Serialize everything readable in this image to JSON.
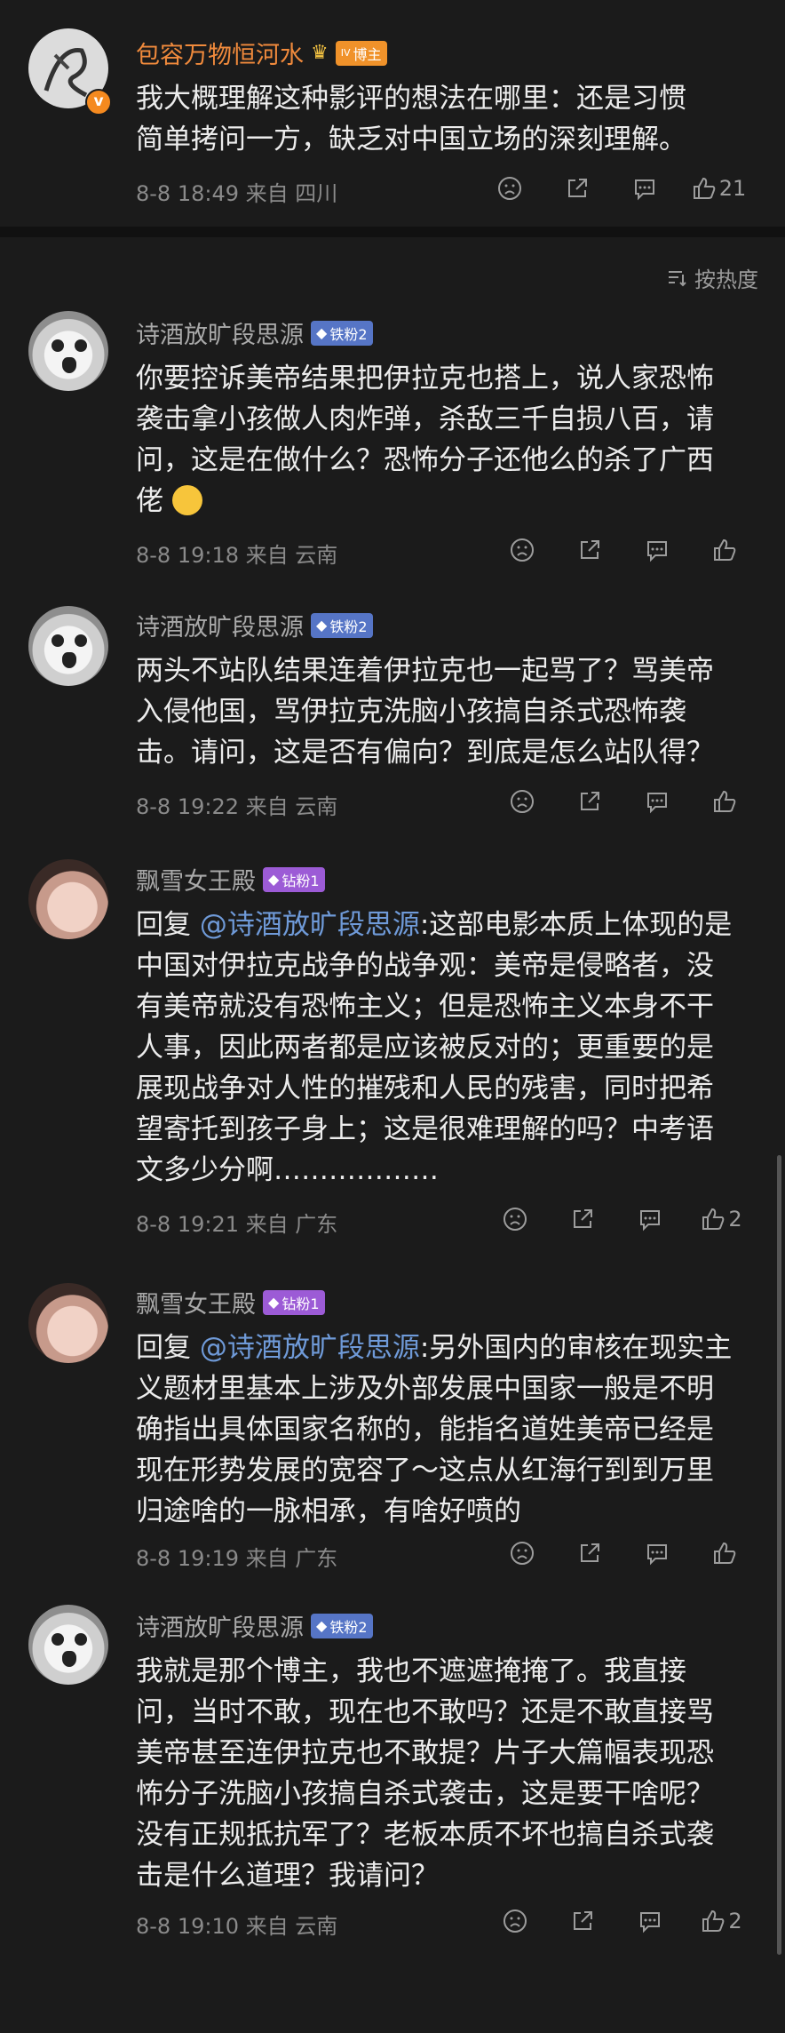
{
  "post": {
    "author": "包容万物恒河水",
    "badge_label": "博主",
    "level": "IV",
    "text_line1": "我大概理解这种影评的想法在哪里：还是习惯",
    "text_line2": "简单拷问一方，缺乏对中国立场的深刻理解。",
    "meta": "8-8 18:49  来自 四川",
    "likes": "21"
  },
  "sort": {
    "label": "按热度"
  },
  "comments": [
    {
      "name": "诗酒放旷段思源",
      "badge": "铁粉2",
      "lines": [
        "你要控诉美帝结果把伊拉克也搭上，说人家恐怖",
        "袭击拿小孩做人肉炸弹，杀敌三千自损八百，请",
        "问，这是在做什么？恐怖分子还他么的杀了广西",
        "佬"
      ],
      "meta": "8-8 19:18  来自 云南",
      "likes": ""
    },
    {
      "name": "诗酒放旷段思源",
      "badge": "铁粉2",
      "lines": [
        "两头不站队结果连着伊拉克也一起骂了？骂美帝",
        "入侵他国，骂伊拉克洗脑小孩搞自杀式恐怖袭",
        "击。请问，这是否有偏向？到底是怎么站队得？"
      ],
      "meta": "8-8 19:22  来自 云南",
      "likes": ""
    },
    {
      "name": "飘雪女王殿",
      "badge": "钻粉1",
      "reply_prefix": "回复 ",
      "mention": "@诗酒放旷段思源",
      "first_rest": ":这部电影本质上体现的是",
      "lines": [
        "中国对伊拉克战争的战争观：美帝是侵略者，没",
        "有美帝就没有恐怖主义；但是恐怖主义本身不干",
        "人事，因此两者都是应该被反对的；更重要的是",
        "展现战争对人性的摧残和人民的残害，同时把希",
        "望寄托到孩子身上；这是很难理解的吗？中考语",
        "文多少分啊………………"
      ],
      "meta": "8-8 19:21  来自 广东",
      "likes": "2"
    },
    {
      "name": "飘雪女王殿",
      "badge": "钻粉1",
      "reply_prefix": "回复 ",
      "mention": "@诗酒放旷段思源",
      "first_rest": ":另外国内的审核在现实主",
      "lines": [
        "义题材里基本上涉及外部发展中国家一般是不明",
        "确指出具体国家名称的，能指名道姓美帝已经是",
        "现在形势发展的宽容了～这点从红海行到到万里",
        "归途啥的一脉相承，有啥好喷的"
      ],
      "meta": "8-8 19:19  来自 广东",
      "likes": ""
    },
    {
      "name": "诗酒放旷段思源",
      "badge": "铁粉2",
      "lines": [
        "我就是那个博主，我也不遮遮掩掩了。我直接",
        "问，当时不敢，现在也不敢吗？还是不敢直接骂",
        "美帝甚至连伊拉克也不敢提？片子大篇幅表现恐",
        "怖分子洗脑小孩搞自杀式袭击，这是要干啥呢？",
        "没有正规抵抗军了？老板本质不坏也搞自杀式袭",
        "击是什么道理？我请问？"
      ],
      "meta": "8-8 19:10  来自 云南",
      "likes": "2"
    }
  ],
  "colors": {
    "background": "#1b1b1b",
    "mention": "#6f9ad8",
    "author_name": "#f08a3c",
    "fan_blue": "#5675c6",
    "fan_purple": "#9c5bd6"
  }
}
